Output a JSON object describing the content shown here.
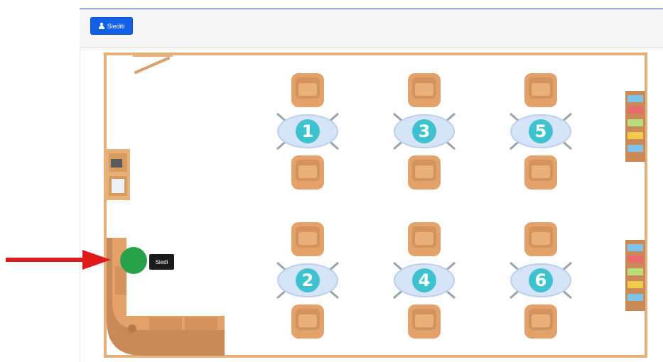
{
  "toolbar": {
    "sit_button_label": "Siediti"
  },
  "room": {
    "tables": [
      {
        "number": "1"
      },
      {
        "number": "2"
      },
      {
        "number": "3"
      },
      {
        "number": "4"
      },
      {
        "number": "5"
      },
      {
        "number": "6"
      }
    ],
    "tooltip": {
      "label": "Siedi"
    }
  },
  "colors": {
    "accent": "#1360e8",
    "wall": "#e6b07a",
    "chair": "#e3a26a",
    "table_top": "#d6e4f7",
    "table_number": "#3fc2d0",
    "avatar": "#27a24a",
    "arrow": "#e0191b"
  },
  "icons": {
    "sit_button_icon": "person-icon"
  }
}
